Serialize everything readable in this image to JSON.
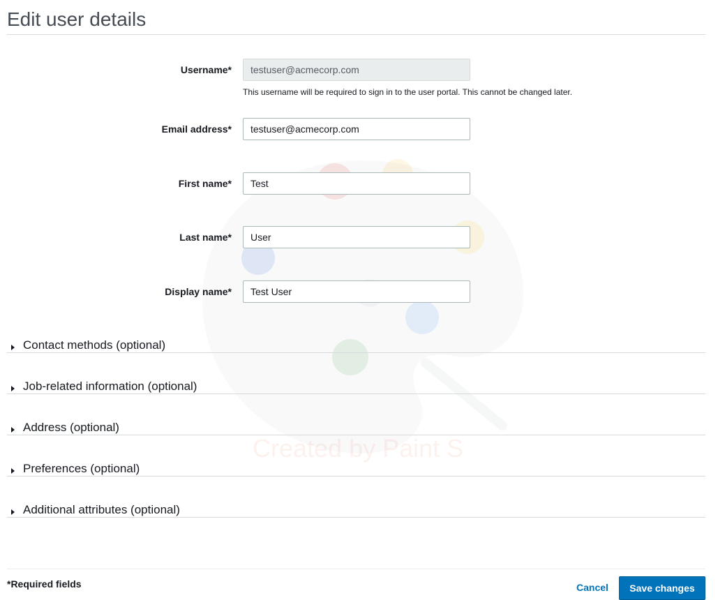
{
  "page": {
    "title": "Edit user details"
  },
  "form": {
    "username": {
      "label": "Username*",
      "value": "testuser@acmecorp.com",
      "hint": "This username will be required to sign in to the user portal. This cannot be changed later.",
      "disabled": true
    },
    "email": {
      "label": "Email address*",
      "value": "testuser@acmecorp.com"
    },
    "first_name": {
      "label": "First name*",
      "value": "Test"
    },
    "last_name": {
      "label": "Last name*",
      "value": "User"
    },
    "display_name": {
      "label": "Display name*",
      "value": "Test User"
    }
  },
  "sections": [
    {
      "label": "Contact methods (optional)",
      "expanded": false
    },
    {
      "label": "Job-related information (optional)",
      "expanded": false
    },
    {
      "label": "Address (optional)",
      "expanded": false
    },
    {
      "label": "Preferences (optional)",
      "expanded": false
    },
    {
      "label": "Additional attributes (optional)",
      "expanded": false
    }
  ],
  "footer": {
    "required_note": "*Required fields",
    "cancel_label": "Cancel",
    "save_label": "Save changes"
  },
  "watermark": {
    "text": "Created by Paint S"
  },
  "colors": {
    "primary": "#0073bb",
    "text": "#16191f",
    "divider": "#d5dbdb",
    "disabled_bg": "#eaeded"
  },
  "icons": {
    "section_toggle": "caret-right-icon",
    "watermark": "paint-palette-icon"
  }
}
